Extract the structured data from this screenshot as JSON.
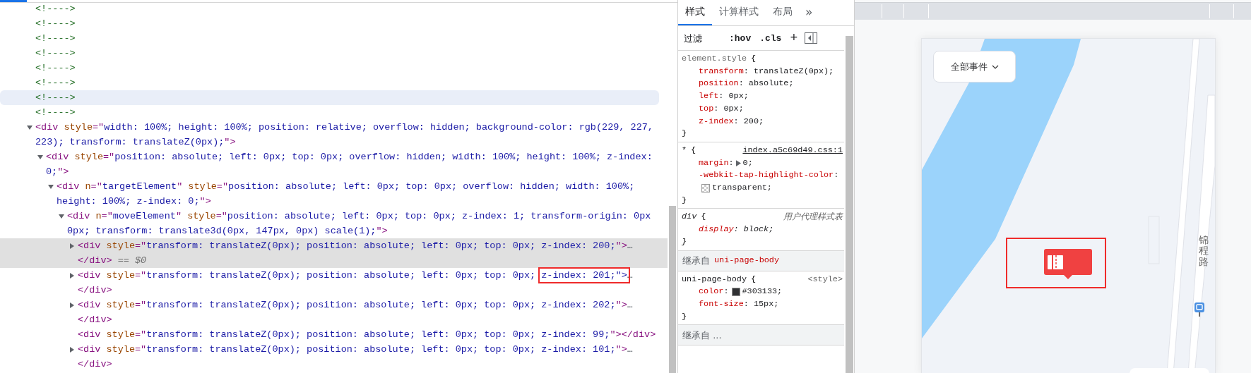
{
  "elements": {
    "nodes": [
      {
        "tokens": [
          {
            "kind": "comment",
            "text": "<!---->"
          }
        ],
        "selected": false,
        "hovered": false
      },
      {
        "tokens": [
          {
            "kind": "comment",
            "text": "<!---->"
          }
        ],
        "selected": false,
        "hovered": false
      },
      {
        "tokens": [
          {
            "kind": "comment",
            "text": "<!---->"
          }
        ],
        "selected": false,
        "hovered": false
      },
      {
        "tokens": [
          {
            "kind": "comment",
            "text": "<!---->"
          }
        ],
        "selected": false,
        "hovered": false
      },
      {
        "tokens": [
          {
            "kind": "comment",
            "text": "<!---->"
          }
        ],
        "selected": false,
        "hovered": false
      },
      {
        "tokens": [
          {
            "kind": "comment",
            "text": "<!---->"
          }
        ],
        "selected": false,
        "hovered": false
      },
      {
        "tokens": [
          {
            "kind": "comment",
            "text": "<!---->"
          }
        ],
        "selected": false,
        "hovered": true
      },
      {
        "tokens": [
          {
            "kind": "comment",
            "text": "<!---->"
          }
        ],
        "selected": false,
        "hovered": false
      },
      {
        "expanded": true,
        "selected": false,
        "hovered": false,
        "tokens": [
          {
            "kind": "tag",
            "text": "<div"
          },
          {
            "kind": "attr",
            "text": " style"
          },
          {
            "kind": "tag",
            "text": "=\""
          },
          {
            "kind": "value",
            "text": "width: 100%; height: 100%; position: relative; overflow: hidden; background-color: rgb(229, 227, 223); transform: translateZ(0px);"
          },
          {
            "kind": "tag",
            "text": "\">"
          }
        ],
        "children": [
          {
            "expanded": true,
            "selected": false,
            "hovered": false,
            "tokens": [
              {
                "kind": "tag",
                "text": "<div"
              },
              {
                "kind": "attr",
                "text": " style"
              },
              {
                "kind": "tag",
                "text": "=\""
              },
              {
                "kind": "value",
                "text": "position: absolute; left: 0px; top: 0px; overflow: hidden; width: 100%; height: 100%; z-index: 0;"
              },
              {
                "kind": "tag",
                "text": "\">"
              }
            ],
            "children": [
              {
                "expanded": true,
                "selected": false,
                "hovered": false,
                "tokens": [
                  {
                    "kind": "tag",
                    "text": "<div"
                  },
                  {
                    "kind": "attr",
                    "text": " n"
                  },
                  {
                    "kind": "tag",
                    "text": "=\""
                  },
                  {
                    "kind": "value",
                    "text": "targetElement"
                  },
                  {
                    "kind": "tag",
                    "text": "\""
                  },
                  {
                    "kind": "attr",
                    "text": " style"
                  },
                  {
                    "kind": "tag",
                    "text": "=\""
                  },
                  {
                    "kind": "value",
                    "text": "position: absolute; left: 0px; top: 0px; overflow: hidden; width: 100%; height: 100%; z-index: 0;"
                  },
                  {
                    "kind": "tag",
                    "text": "\">"
                  }
                ],
                "children": [
                  {
                    "expanded": true,
                    "selected": false,
                    "hovered": false,
                    "tokens": [
                      {
                        "kind": "tag",
                        "text": "<div"
                      },
                      {
                        "kind": "attr",
                        "text": " n"
                      },
                      {
                        "kind": "tag",
                        "text": "=\""
                      },
                      {
                        "kind": "value",
                        "text": "moveElement"
                      },
                      {
                        "kind": "tag",
                        "text": "\""
                      },
                      {
                        "kind": "attr",
                        "text": " style"
                      },
                      {
                        "kind": "tag",
                        "text": "=\""
                      },
                      {
                        "kind": "value",
                        "text": "position: absolute; left: 0px; top: 0px; z-index: 1; transform-origin: 0px 0px; transform: translate3d(0px, 147px, 0px) scale(1);"
                      },
                      {
                        "kind": "tag",
                        "text": "\">"
                      }
                    ],
                    "children": [
                      {
                        "expanded": false,
                        "selected": true,
                        "hovered": false,
                        "tokens": [
                          {
                            "kind": "tag",
                            "text": "<div"
                          },
                          {
                            "kind": "attr",
                            "text": " style"
                          },
                          {
                            "kind": "tag",
                            "text": "=\""
                          },
                          {
                            "kind": "value",
                            "text": "transform: translateZ(0px); position: absolute; left: 0px; top: 0px; z-index: 200;"
                          },
                          {
                            "kind": "tag",
                            "text": "\">"
                          },
                          {
                            "kind": "ellipsis",
                            "text": "…"
                          },
                          {
                            "kind": "tag",
                            "text": " </div>"
                          },
                          {
                            "kind": "note",
                            "text": " == $0"
                          }
                        ]
                      },
                      {
                        "expanded": false,
                        "selected": false,
                        "hovered": false,
                        "tokens": [
                          {
                            "kind": "tag",
                            "text": "<div"
                          },
                          {
                            "kind": "attr",
                            "text": " style"
                          },
                          {
                            "kind": "tag",
                            "text": "=\""
                          },
                          {
                            "kind": "value",
                            "text": "transform: translateZ(0px); position: absolute; left: 0px; top: 0px; "
                          },
                          {
                            "kind": "value-boxed",
                            "text": "z-index: 201;\">"
                          },
                          {
                            "kind": "ellipsis",
                            "text": "…"
                          },
                          {
                            "kind": "tag",
                            "text": " </div>"
                          }
                        ]
                      },
                      {
                        "expanded": false,
                        "selected": false,
                        "hovered": false,
                        "tokens": [
                          {
                            "kind": "tag",
                            "text": "<div"
                          },
                          {
                            "kind": "attr",
                            "text": " style"
                          },
                          {
                            "kind": "tag",
                            "text": "=\""
                          },
                          {
                            "kind": "value",
                            "text": "transform: translateZ(0px); position: absolute; left: 0px; top: 0px; z-index: 202;"
                          },
                          {
                            "kind": "tag",
                            "text": "\">"
                          },
                          {
                            "kind": "ellipsis",
                            "text": "…"
                          },
                          {
                            "kind": "tag",
                            "text": " </div>"
                          }
                        ]
                      },
                      {
                        "selected": false,
                        "hovered": false,
                        "tokens": [
                          {
                            "kind": "tag",
                            "text": "<div"
                          },
                          {
                            "kind": "attr",
                            "text": " style"
                          },
                          {
                            "kind": "tag",
                            "text": "=\""
                          },
                          {
                            "kind": "value",
                            "text": "transform: translateZ(0px); position: absolute; left: 0px; top: 0px; z-index: 99;"
                          },
                          {
                            "kind": "tag",
                            "text": "\"></div>"
                          }
                        ]
                      },
                      {
                        "expanded": false,
                        "selected": false,
                        "hovered": false,
                        "tokens": [
                          {
                            "kind": "tag",
                            "text": "<div"
                          },
                          {
                            "kind": "attr",
                            "text": " style"
                          },
                          {
                            "kind": "tag",
                            "text": "=\""
                          },
                          {
                            "kind": "value",
                            "text": "transform: translateZ(0px); position: absolute; left: 0px; top: 0px; z-index: 101;"
                          },
                          {
                            "kind": "tag",
                            "text": "\">"
                          },
                          {
                            "kind": "ellipsis",
                            "text": "…"
                          },
                          {
                            "kind": "tag",
                            "text": " </div>"
                          }
                        ]
                      }
                    ]
                  }
                ]
              }
            ]
          }
        ]
      }
    ]
  },
  "styles": {
    "tabs": [
      {
        "label": "样式",
        "selected": true
      },
      {
        "label": "计算样式",
        "selected": false
      },
      {
        "label": "布局",
        "selected": false
      }
    ],
    "more": "»",
    "filter": {
      "placeholder": "过滤"
    },
    "hov": ":hov",
    "cls": ".cls",
    "new_rule": "+",
    "sections": [
      {
        "kind": "inline-rule",
        "selector": "element.style",
        "open": "{",
        "close": "}",
        "properties": [
          {
            "name": "transform",
            "colon": ":",
            "value": " translateZ(0px);"
          },
          {
            "name": "position",
            "colon": ":",
            "value": " absolute;"
          },
          {
            "name": "left",
            "colon": ":",
            "value": " 0px;"
          },
          {
            "name": "top",
            "colon": ":",
            "value": " 0px;"
          },
          {
            "name": "z-index",
            "colon": ":",
            "value": " 200;"
          }
        ]
      },
      {
        "kind": "author-rule",
        "selector": "*",
        "open": "{",
        "source": "index.a5c69d49.css:1",
        "source_link": true,
        "close": "}",
        "properties": [
          {
            "name": "margin",
            "colon": ":",
            "expandable": true,
            "value": "0;"
          },
          {
            "name": "-webkit-tap-highlight-color",
            "colon": ":",
            "swatch": {
              "kind": "transparent"
            },
            "value": "transparent;"
          }
        ]
      },
      {
        "kind": "ua-rule",
        "selector": "div",
        "open": "{",
        "source": "用户代理样式表",
        "close": "}",
        "properties": [
          {
            "name": "display",
            "colon": ":",
            "value": " block;"
          }
        ]
      },
      {
        "kind": "inherited",
        "label": "继承自",
        "element": "uni-page-body"
      },
      {
        "kind": "author-rule",
        "selector": "uni-page-body",
        "open": "{",
        "source": "<style>",
        "source_link": false,
        "close": "}",
        "properties": [
          {
            "name": "color",
            "colon": ":",
            "swatch": {
              "kind": "solid",
              "color": "#303133"
            },
            "value": "#303133;"
          },
          {
            "name": "font-size",
            "colon": ":",
            "value": " 15px;"
          }
        ]
      },
      {
        "kind": "inherited",
        "label": "继承自 ..."
      }
    ]
  },
  "preview": {
    "filter_button": {
      "label": "全部事件"
    },
    "road_label": "锦程路"
  }
}
